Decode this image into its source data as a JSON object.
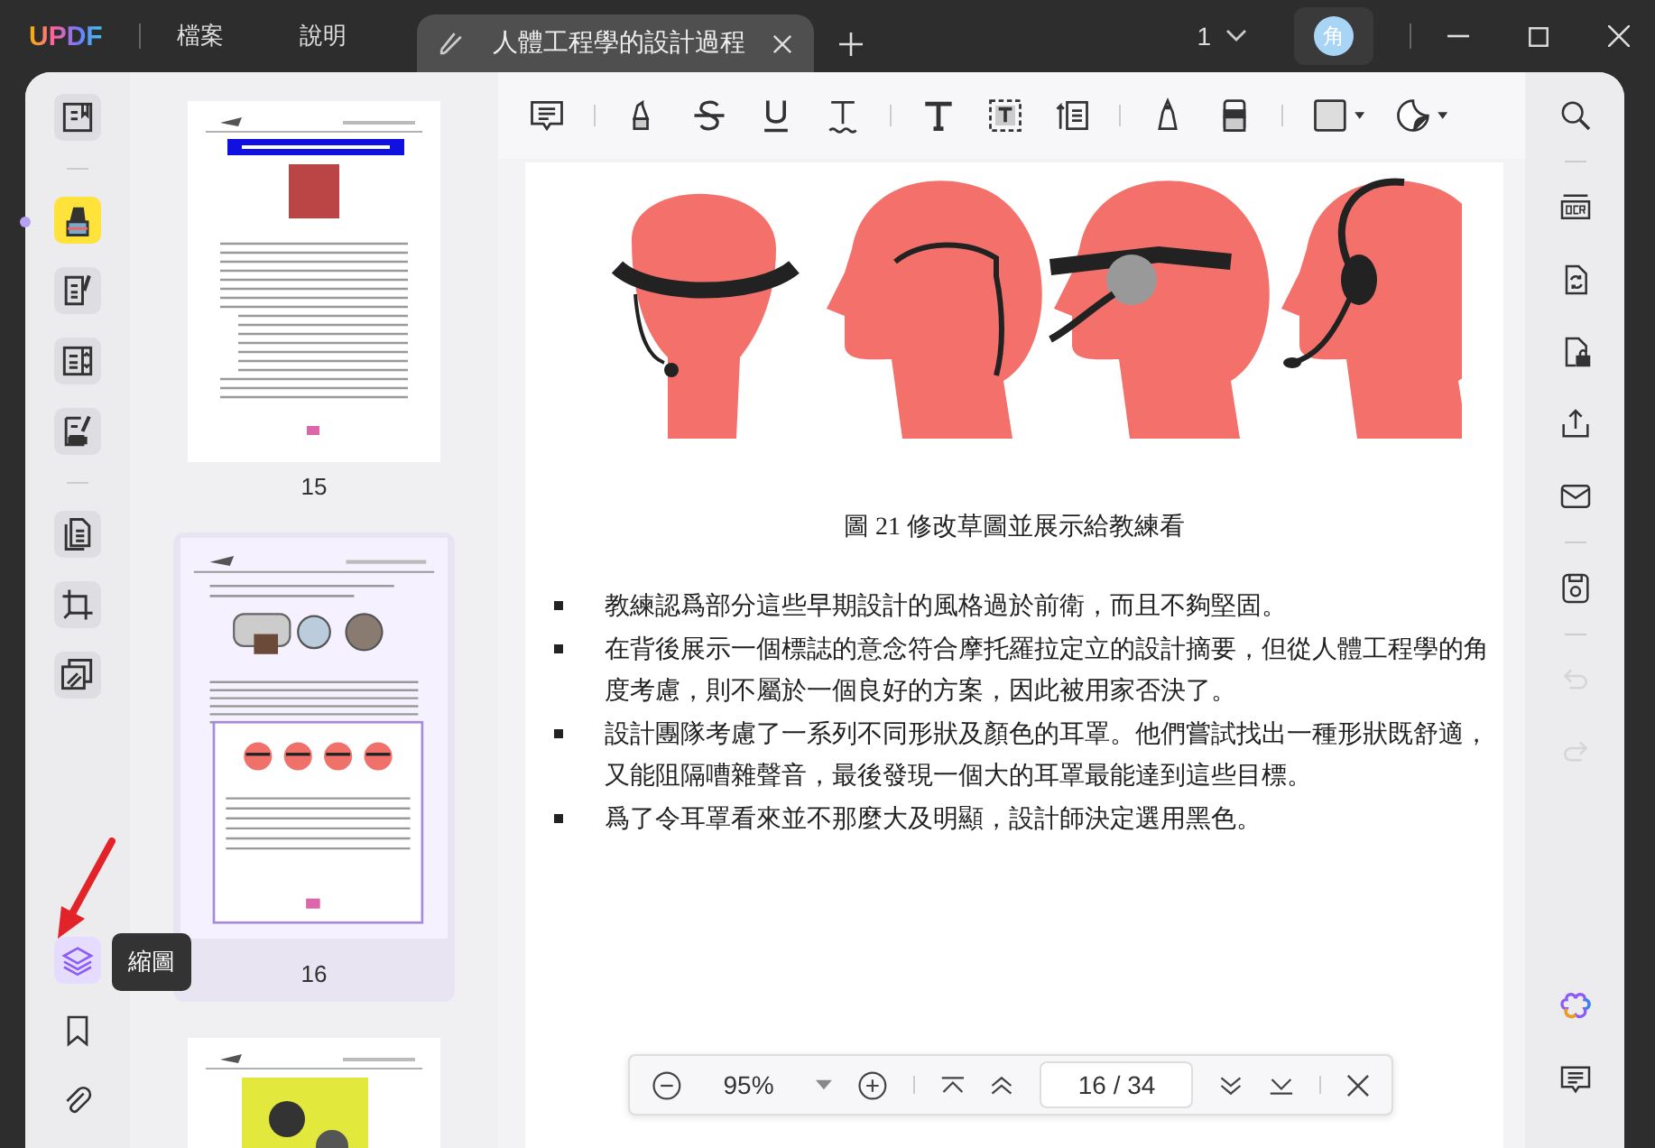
{
  "app": {
    "logo": "UPDF",
    "menu": [
      "檔案",
      "說明"
    ]
  },
  "tab": {
    "title": "人體工程學的設計過程"
  },
  "title_bar": {
    "window_count": "1",
    "avatar": "角"
  },
  "left_tools": [
    {
      "selected": false
    },
    {
      "selected": true
    },
    {
      "selected": false
    },
    {
      "selected": false
    },
    {
      "selected": false
    },
    {
      "selected": false
    },
    {
      "selected": false
    },
    {
      "selected": false
    }
  ],
  "bottom_tools": [
    {
      "selected": true
    },
    {
      "selected": false
    },
    {
      "selected": false
    }
  ],
  "tooltip": "縮圖",
  "thumbnails": [
    {
      "label": "15",
      "selected": false
    },
    {
      "label": "16",
      "selected": true
    },
    {
      "selected": false
    }
  ],
  "document": {
    "caption": "圖 21  修改草圖並展示給教練看",
    "bullets": [
      "教練認爲部分這些早期設計的風格過於前衛，而且不夠堅固。",
      "在背後展示一個標誌的意念符合摩托羅拉定立的設計摘要，但從人體工程學的角度考慮，則不屬於一個良好的方案，因此被用家否決了。",
      "設計團隊考慮了一系列不同形狀及顏色的耳罩。他們嘗試找出一種形狀既舒適，又能阻隔嘈雜聲音，最後發現一個大的耳罩最能達到這些目標。",
      "爲了令耳罩看來並不那麼大及明顯，設計師決定選用黑色。"
    ]
  },
  "zoom_bar": {
    "zoom": "95%",
    "page": "16 / 34"
  },
  "right_tools": [
    {
      "disabled": false
    },
    {
      "disabled": false
    },
    {
      "disabled": false
    },
    {
      "disabled": false
    },
    {
      "disabled": false
    },
    {
      "disabled": false
    },
    {
      "disabled": false
    },
    {
      "disabled": true
    },
    {
      "disabled": true
    },
    {
      "disabled": false
    },
    {
      "disabled": false
    }
  ]
}
